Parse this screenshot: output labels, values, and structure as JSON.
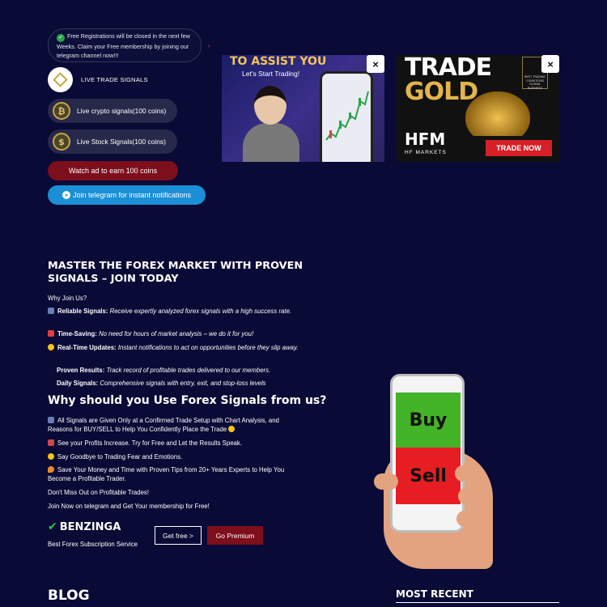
{
  "notice": {
    "text": "Free Registrations will be closed in the next few Weeks. Claim your Free membership by joining our telegram channel now!!!"
  },
  "sidebar": {
    "live_trade_label": "LIVE TRADE SIGNALS",
    "crypto_label": "Live crypto signals(100 coins)",
    "stock_label": "Live Stock Signals(100 coins)",
    "watch_ad_label": "Watch ad to earn 100 coins",
    "telegram_label": "Join telegram for instant notifications"
  },
  "ads": {
    "ad1": {
      "headline": "TO ASSIST YOU",
      "sub": "Let's Start Trading!"
    },
    "ad2": {
      "line1": "TRADE",
      "line2": "GOLD",
      "brand": "HFM",
      "brand_sub": "HF MARKETS",
      "badge": "BEST TRADING CONDITIONS GLOBAL BUSINESS",
      "cta": "TRADE NOW"
    },
    "close_symbol": "×"
  },
  "article": {
    "title": "MASTER THE FOREX MARKET WITH PROVEN SIGNALS – JOIN TODAY",
    "why_join": "Why Join Us?",
    "items": [
      {
        "label": "Reliable Signals:",
        "text": "Receive expertly analyzed forex signals with a high success rate."
      },
      {
        "label": "Time-Saving:",
        "text": "No need for hours of market analysis – we do it for you!"
      },
      {
        "label": "Real-Time Updates:",
        "text": "Instant notifications to act on opportunities before they slip away."
      },
      {
        "label": "Proven Results:",
        "text": "Track record of profitable trades delivered to our members."
      },
      {
        "label": "Daily Signals:",
        "text": "Comprehensive signals with entry, exit, and stop-loss levels"
      }
    ],
    "why_heading": "Why should you Use Forex Signals from us?",
    "points": [
      "All Signals are Given Only at a Confirmed Trade Setup with Chart Analysis, and Reasons for BUY/SELL to Help You Confidently Place the Trade",
      "See your Profits Increase. Try for Free and Let the Results Speak.",
      "Say Goodbye to Trading Fear and Emotions.",
      "Save Your Money and Time with Proven Tips from 20+ Years Experts to Help You Become a Profitable Trader."
    ],
    "dont_miss": "Don't Miss Out on Profitable Trades!",
    "join_now": "Join Now on telegram and Get Your membership for Free!"
  },
  "benzinga": {
    "name": "BENZINGA",
    "sub": "Best Forex Subscription Service",
    "free_button": "Get free >",
    "premium_button": "Go Premium"
  },
  "phone": {
    "buy": "Buy",
    "sell": "Sell"
  },
  "footer": {
    "blog": "BLOG",
    "most_recent": "MOST RECENT"
  },
  "colors": {
    "background": "#0a0a36",
    "accent_red": "#7d0e1b",
    "accent_blue": "#1a8fd6"
  }
}
